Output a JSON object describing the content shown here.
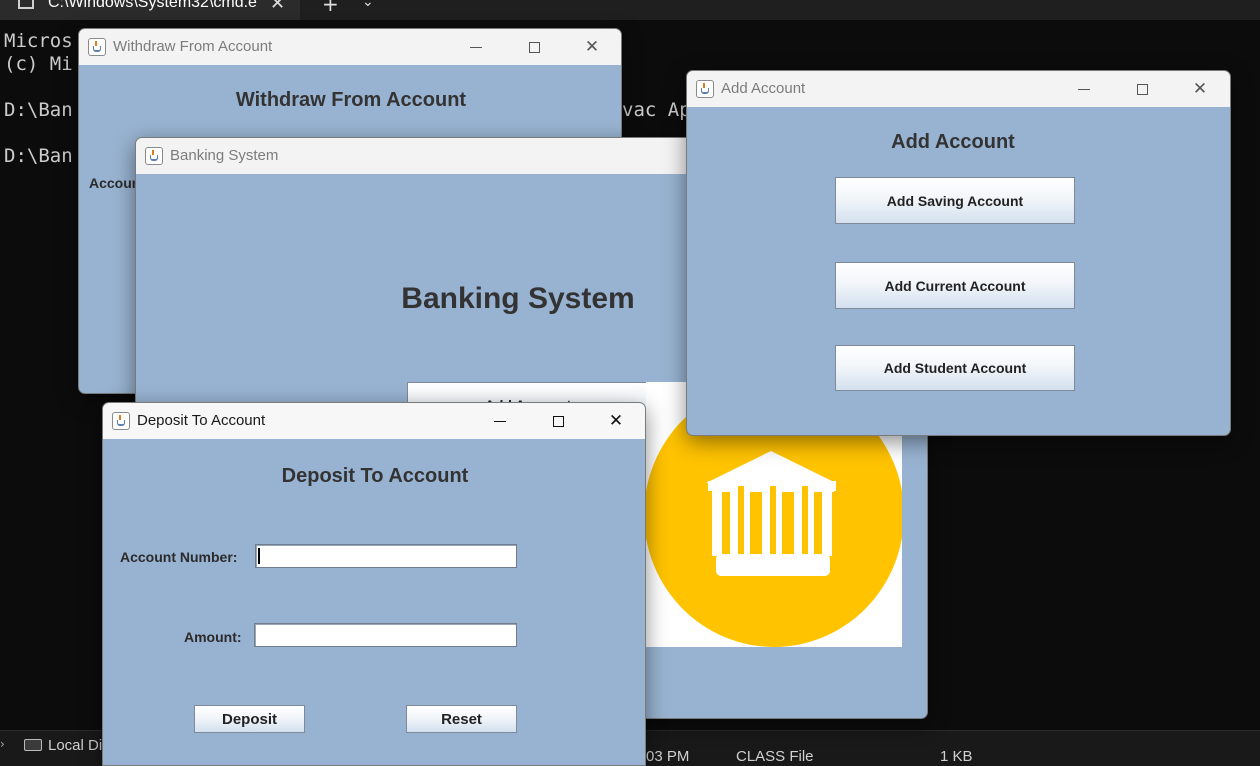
{
  "terminal": {
    "tab_title": "C:\\Windows\\System32\\cmd.e",
    "tab_close": "✕",
    "new_tab": "+",
    "tab_dropdown": "⌄",
    "lines": [
      "Micros",
      "(c) Mi",
      "D:\\Ban",
      "D:\\Ban"
    ],
    "fragment": "vac Ap"
  },
  "explorer": {
    "drive_label": "Local Di",
    "time_fragment": "03 PM",
    "file_type": "CLASS File",
    "file_size": "1 KB"
  },
  "windows": {
    "withdraw": {
      "title": "Withdraw From Account",
      "heading": "Withdraw From Account",
      "account_label_partial": "Accoun"
    },
    "banking": {
      "title": "Banking System",
      "heading": "Banking System",
      "add_account_button": "Add Account"
    },
    "add_account": {
      "title": "Add Account",
      "heading": "Add Account",
      "buttons": [
        "Add Saving Account",
        "Add Current Account",
        "Add Student Account"
      ]
    },
    "deposit": {
      "title": "Deposit To Account",
      "heading": "Deposit To Account",
      "account_number_label": "Account Number:",
      "account_number_value": "",
      "amount_label": "Amount:",
      "amount_value": "",
      "deposit_button": "Deposit",
      "reset_button": "Reset"
    }
  },
  "window_controls": {
    "minimize": "—",
    "maximize": "☐",
    "close": "✕"
  },
  "colors": {
    "window_body": "#98b3d1",
    "logo_yellow": "#ffc300",
    "terminal_bg": "#0c0c0c"
  },
  "icons": {
    "window_icon": "java-cup-icon",
    "logo": "bank-building-icon"
  }
}
